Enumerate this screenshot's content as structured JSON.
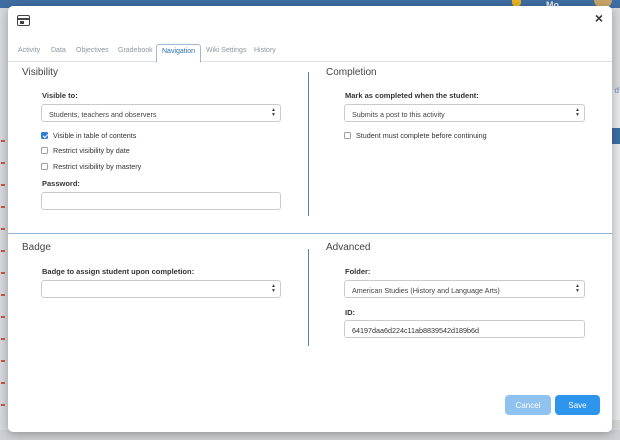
{
  "backdrop": {
    "user_label": "Mo",
    "right_label": "d"
  },
  "tabs": [
    {
      "label": "Activity",
      "active": false
    },
    {
      "label": "Data",
      "active": false
    },
    {
      "label": "Objectives",
      "active": false
    },
    {
      "label": "Gradebook",
      "active": false
    },
    {
      "label": "Navigation",
      "active": true
    },
    {
      "label": "Wiki Settings",
      "active": false
    },
    {
      "label": "History",
      "active": false
    }
  ],
  "header": {
    "close_glyph": "×"
  },
  "visibility": {
    "title": "Visibility",
    "visible_to_label": "Visible to:",
    "visible_to_value": "Students, teachers and observers",
    "checks": [
      {
        "label": "Visible in table of contents",
        "checked": true
      },
      {
        "label": "Restrict visibility by date",
        "checked": false
      },
      {
        "label": "Restrict visibility by mastery",
        "checked": false
      }
    ],
    "password_label": "Password:",
    "password_value": ""
  },
  "completion": {
    "title": "Completion",
    "mark_label": "Mark as completed when the student:",
    "mark_value": "Submits a post to this activity",
    "must_complete_label": "Student must complete before continuing",
    "must_complete_checked": false
  },
  "badge": {
    "title": "Badge",
    "assign_label": "Badge to assign student upon completion:",
    "assign_value": ""
  },
  "advanced": {
    "title": "Advanced",
    "folder_label": "Folder:",
    "folder_value": "American Studies (History and Language Arts)",
    "id_label": "ID:",
    "id_value": "64197daa6d224c11ab8839542d189b6d"
  },
  "footer": {
    "cancel_label": "Cancel",
    "save_label": "Save"
  },
  "icons": {
    "header": "window-icon",
    "close": "close-icon",
    "select_arrows": "updown-arrows-icon"
  },
  "colors": {
    "accent": "#2d95ec",
    "cancel": "#8fc2ee",
    "divider": "#4c86c2",
    "checkbox": "#2f7fd1"
  }
}
